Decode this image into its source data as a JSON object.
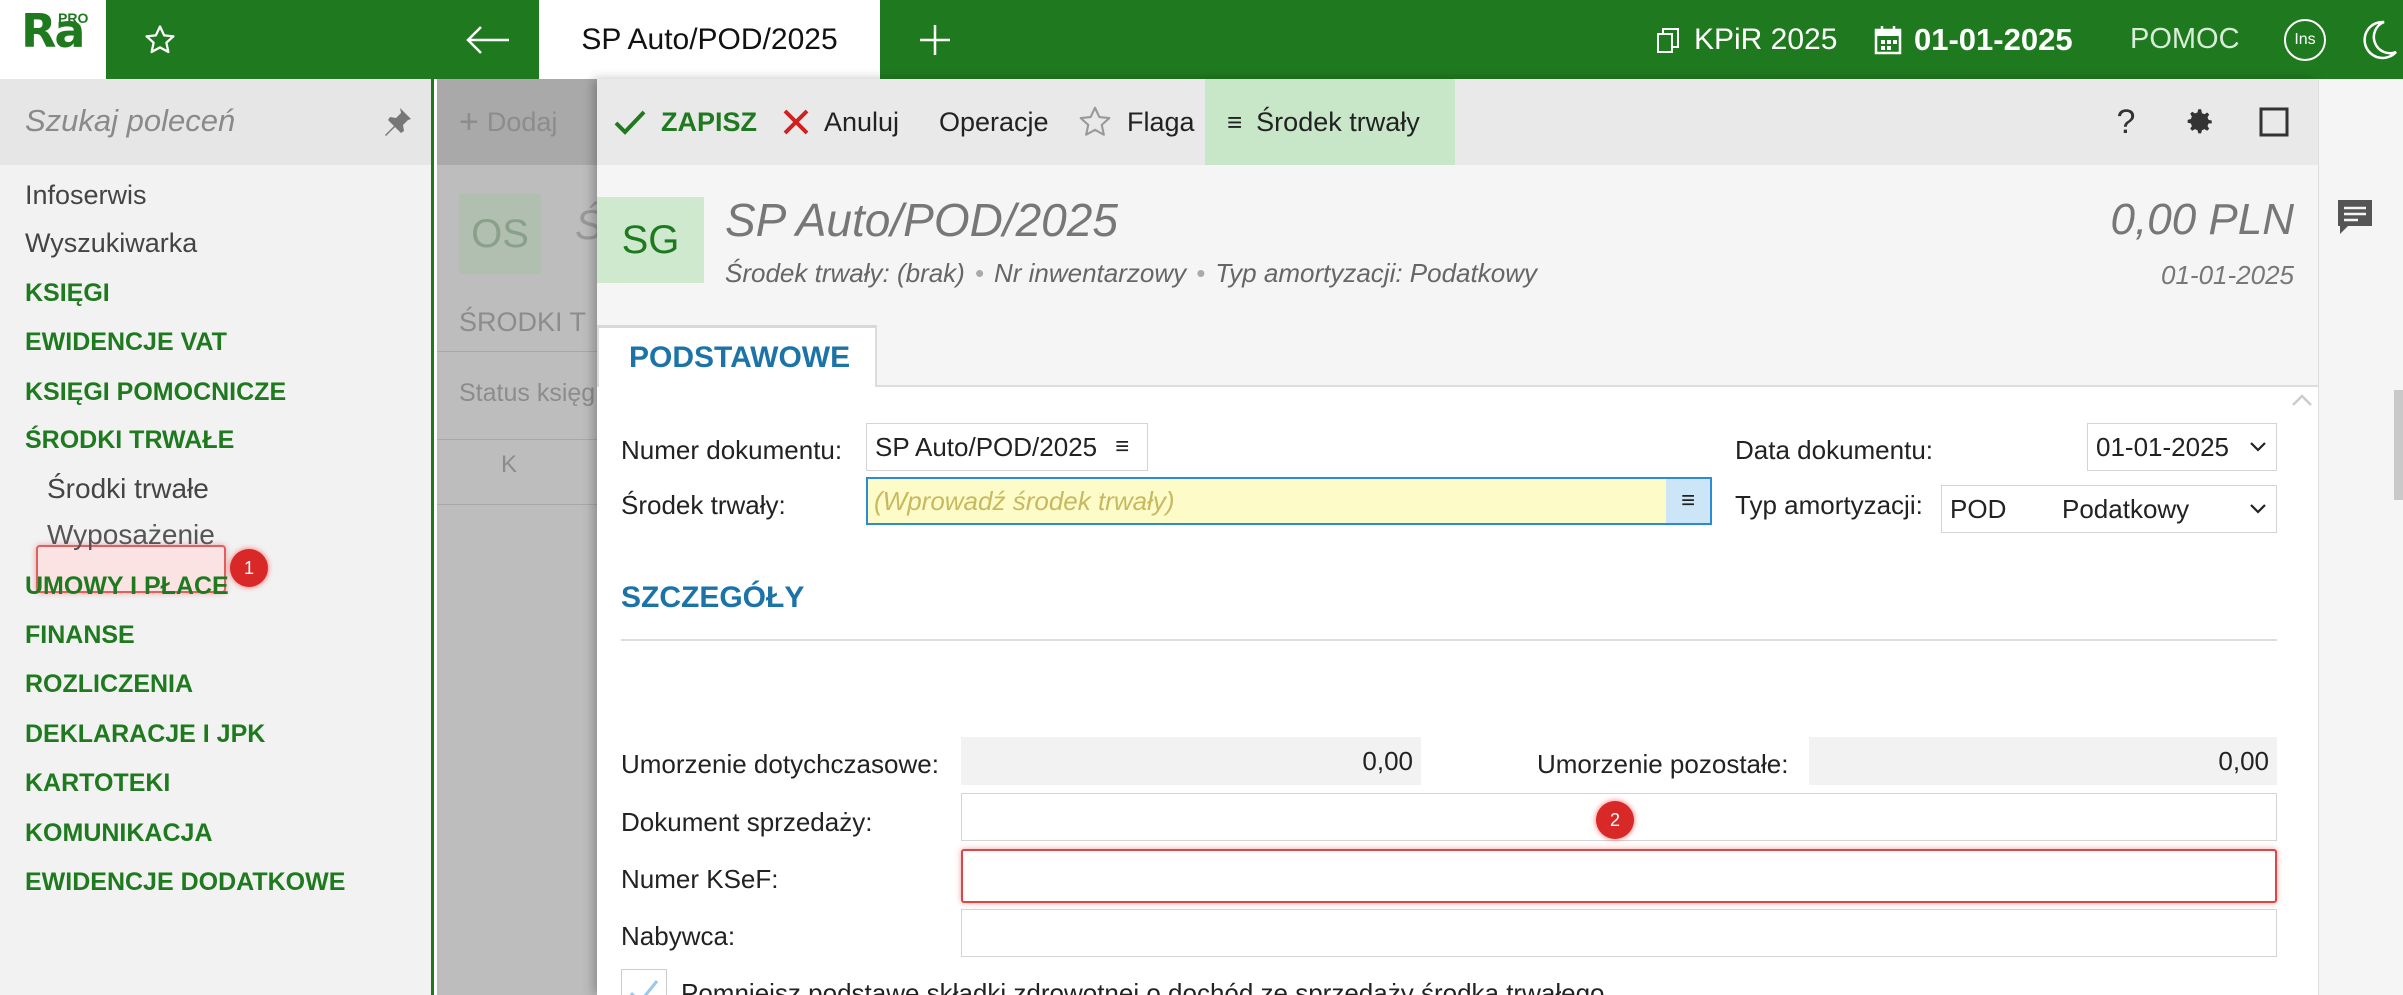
{
  "app": {
    "logo_text": "Ra",
    "logo_sup": "PRO"
  },
  "topbar": {
    "doc_tab": "SP Auto/POD/2025",
    "book": "KPiR 2025",
    "date": "01-01-2025",
    "help": "POMOC",
    "ins": "Ins"
  },
  "sidebar": {
    "search_placeholder": "Szukaj poleceń",
    "items": [
      {
        "label": "Infoserwis",
        "type": "plain"
      },
      {
        "label": "Wyszukiwarka",
        "type": "plain"
      },
      {
        "label": "KSIĘGI",
        "type": "section"
      },
      {
        "label": "EWIDENCJE VAT",
        "type": "section"
      },
      {
        "label": "KSIĘGI POMOCNICZE",
        "type": "section"
      },
      {
        "label": "ŚRODKI TRWAŁE",
        "type": "section"
      },
      {
        "label": "Środki trwałe",
        "type": "sub",
        "active": true
      },
      {
        "label": "Wyposażenie",
        "type": "sub"
      },
      {
        "label": "UMOWY I PŁACE",
        "type": "section"
      },
      {
        "label": "FINANSE",
        "type": "section"
      },
      {
        "label": "ROZLICZENIA",
        "type": "section"
      },
      {
        "label": "DEKLARACJE I JPK",
        "type": "section"
      },
      {
        "label": "KARTOTEKI",
        "type": "section"
      },
      {
        "label": "KOMUNIKACJA",
        "type": "section"
      },
      {
        "label": "EWIDENCJE DODATKOWE",
        "type": "section"
      }
    ],
    "badge_1": "1"
  },
  "background_panel": {
    "add_label": "Dodaj",
    "os_label": "OS",
    "s_fragment": "Ś",
    "list_title": "ŚRODKI T",
    "status": "Status księg",
    "col_k": "K"
  },
  "modal": {
    "toolbar": {
      "save": "ZAPISZ",
      "cancel": "Anuluj",
      "operations": "Operacje",
      "flag": "Flaga",
      "asset": "Środek trwały"
    },
    "header": {
      "badge": "SG",
      "title": "SP Auto/POD/2025",
      "meta_asset": "Środek trwały: (brak)",
      "meta_inventory": "Nr inwentarzowy",
      "meta_type": "Typ amortyzacji: Podatkowy",
      "amount": "0,00 PLN",
      "date": "01-01-2025"
    },
    "tab": "PODSTAWOWE",
    "form": {
      "doc_number_label": "Numer dokumentu:",
      "doc_number_value": "SP Auto/POD/2025",
      "asset_label": "Środek trwały:",
      "asset_placeholder": "(Wprowadź środek trwały)",
      "doc_date_label": "Data dokumentu:",
      "doc_date_value": "01-01-2025",
      "amort_type_label": "Typ amortyzacji:",
      "amort_type_code": "POD",
      "amort_type_name": "Podatkowy"
    },
    "details": {
      "title": "SZCZEGÓŁY",
      "umorzenie_dotych_label": "Umorzenie dotychczasowe:",
      "umorzenie_dotych_value": "0,00",
      "umorzenie_poz_label": "Umorzenie pozostałe:",
      "umorzenie_poz_value": "0,00",
      "sales_doc_label": "Dokument sprzedaży:",
      "ksef_label": "Numer KSeF:",
      "buyer_label": "Nabywca:",
      "checkbox_label": "Pomniejsz podstawę składki zdrowotnej o dochód ze sprzedaży środka trwałego",
      "badge_2": "2"
    }
  },
  "colors": {
    "brand": "#1f7a1f",
    "accent_blue": "#1b73a8",
    "highlight_red": "#e04444"
  }
}
